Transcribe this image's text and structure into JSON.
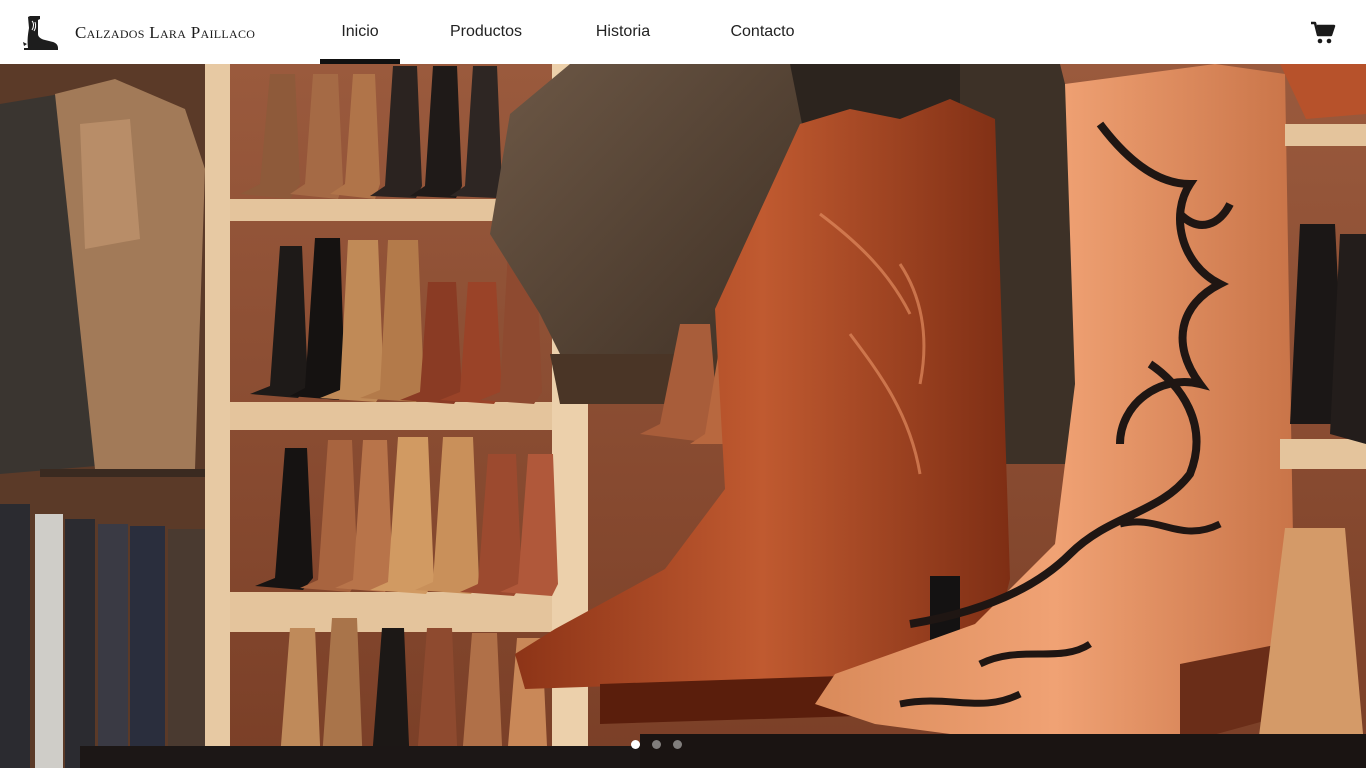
{
  "brand": {
    "name": "Calzados Lara Paillaco",
    "icon": "cowboy-boot-icon"
  },
  "nav": {
    "items": [
      {
        "label": "Inicio",
        "active": true
      },
      {
        "label": "Productos",
        "active": false
      },
      {
        "label": "Historia",
        "active": false
      },
      {
        "label": "Contacto",
        "active": false
      }
    ]
  },
  "cart": {
    "icon": "shopping-cart-icon"
  },
  "hero": {
    "image": "western-boots-store-interior",
    "slides": 3,
    "active_slide": 1
  },
  "colors": {
    "header_bg": "#ffffff",
    "nav_active_underline": "#111111",
    "text": "#222222"
  }
}
